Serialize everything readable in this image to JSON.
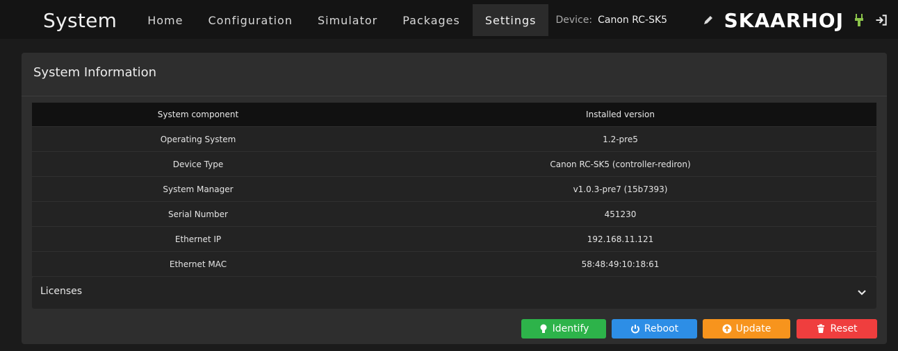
{
  "header": {
    "brand": "System",
    "nav": [
      "Home",
      "Configuration",
      "Simulator",
      "Packages",
      "Settings"
    ],
    "active_nav": "Settings",
    "device_label": "Device:",
    "device_value": "Canon RC-SK5",
    "logo_text": "SKAARHOJ",
    "icons": {
      "edit": "pencil-icon",
      "power_status": "plug-icon",
      "logout": "logout-icon"
    },
    "colors": {
      "plug": "#8bc34a"
    }
  },
  "panel": {
    "title": "System Information",
    "table": {
      "headers": [
        "System component",
        "Installed version"
      ],
      "rows": [
        [
          "Operating System",
          "1.2-pre5"
        ],
        [
          "Device Type",
          "Canon RC-SK5 (controller-rediron)"
        ],
        [
          "System Manager",
          "v1.0.3-pre7 (15b7393)"
        ],
        [
          "Serial Number",
          "451230"
        ],
        [
          "Ethernet IP",
          "192.168.11.121"
        ],
        [
          "Ethernet MAC",
          "58:48:49:10:18:61"
        ]
      ]
    },
    "licenses_label": "Licenses",
    "buttons": {
      "identify": "Identify",
      "reboot": "Reboot",
      "update": "Update",
      "reset": "Reset"
    },
    "button_colors": {
      "identify": "#2db34a",
      "reboot": "#2d8ee6",
      "update": "#f7941d",
      "reset": "#ef3e3e"
    }
  }
}
